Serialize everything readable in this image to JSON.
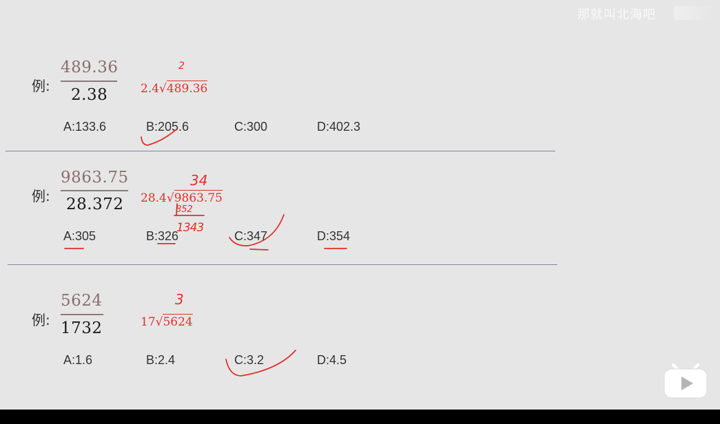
{
  "watermark": "那就叫北海吧",
  "examples": [
    {
      "label": "例:",
      "numerator": "489.36",
      "denominator": "2.38",
      "division_divisor": "2.4",
      "division_dividend": "489.36",
      "options": [
        "A:133.6",
        "B:205.6",
        "C:300",
        "D:402.3"
      ],
      "handwritten_quotient": "2"
    },
    {
      "label": "例:",
      "numerator": "9863.75",
      "denominator": "28.372",
      "division_divisor": "28.4",
      "division_dividend": "9863.75",
      "options": [
        "A:305",
        "B:326",
        "C:347",
        "D:354"
      ],
      "handwritten_quotient": "34",
      "handwritten_work_1": "852",
      "handwritten_work_2": "1343"
    },
    {
      "label": "例:",
      "numerator": "5624",
      "denominator": "1732",
      "division_divisor": "17",
      "division_dividend": "5624",
      "options": [
        "A:1.6",
        "B:2.4",
        "C:3.2",
        "D:4.5"
      ],
      "handwritten_quotient": "3"
    }
  ],
  "colors": {
    "background": "#e6e6e6",
    "annotation_red": "#e0302b",
    "numerator": "#8b6e6e",
    "divider": "#7a8aa3"
  },
  "icons": {
    "play": "play-icon"
  }
}
